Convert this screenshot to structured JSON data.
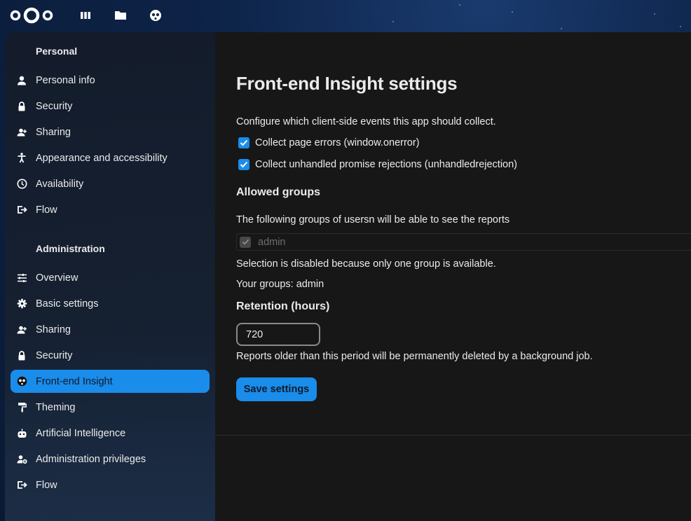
{
  "topbar": {
    "logo": "nextcloud-logo",
    "apps": [
      {
        "name": "dashboard-icon"
      },
      {
        "name": "files-icon"
      },
      {
        "name": "front-end-insight-icon"
      }
    ]
  },
  "sidebar": {
    "personal_title": "Personal",
    "personal_items": [
      {
        "label": "Personal info",
        "icon": "user-icon"
      },
      {
        "label": "Security",
        "icon": "lock-icon"
      },
      {
        "label": "Sharing",
        "icon": "share-icon"
      },
      {
        "label": "Appearance and accessibility",
        "icon": "accessibility-icon"
      },
      {
        "label": "Availability",
        "icon": "clock-icon"
      },
      {
        "label": "Flow",
        "icon": "flow-icon"
      }
    ],
    "admin_title": "Administration",
    "admin_items": [
      {
        "label": "Overview",
        "icon": "tune-icon"
      },
      {
        "label": "Basic settings",
        "icon": "gear-icon"
      },
      {
        "label": "Sharing",
        "icon": "share-icon"
      },
      {
        "label": "Security",
        "icon": "lock-icon"
      },
      {
        "label": "Front-end Insight",
        "icon": "front-end-insight-icon",
        "active": true
      },
      {
        "label": "Theming",
        "icon": "paint-roller-icon"
      },
      {
        "label": "Artificial Intelligence",
        "icon": "robot-icon"
      },
      {
        "label": "Administration privileges",
        "icon": "user-cog-icon"
      },
      {
        "label": "Flow",
        "icon": "flow-icon"
      }
    ]
  },
  "main": {
    "title": "Front-end Insight settings",
    "description": "Configure which client-side events this app should collect.",
    "options": [
      {
        "label": "Collect page errors (window.onerror)",
        "checked": true
      },
      {
        "label": "Collect unhandled promise rejections (unhandledrejection)",
        "checked": true
      }
    ],
    "groups_heading": "Allowed groups",
    "groups_description": "The following groups of usersn will be able to see the reports",
    "group_option": {
      "label": "admin",
      "checked": true,
      "disabled": true
    },
    "groups_disabled_note": "Selection is disabled because only one group is available.",
    "your_groups": "Your groups: admin",
    "retention_heading": "Retention (hours)",
    "retention_value": "720",
    "retention_note": "Reports older than this period will be permanently deleted by a background job.",
    "save_label": "Save settings"
  },
  "colors": {
    "accent": "#1a8cea",
    "content_bg": "#171717",
    "text": "#ebebeb"
  }
}
